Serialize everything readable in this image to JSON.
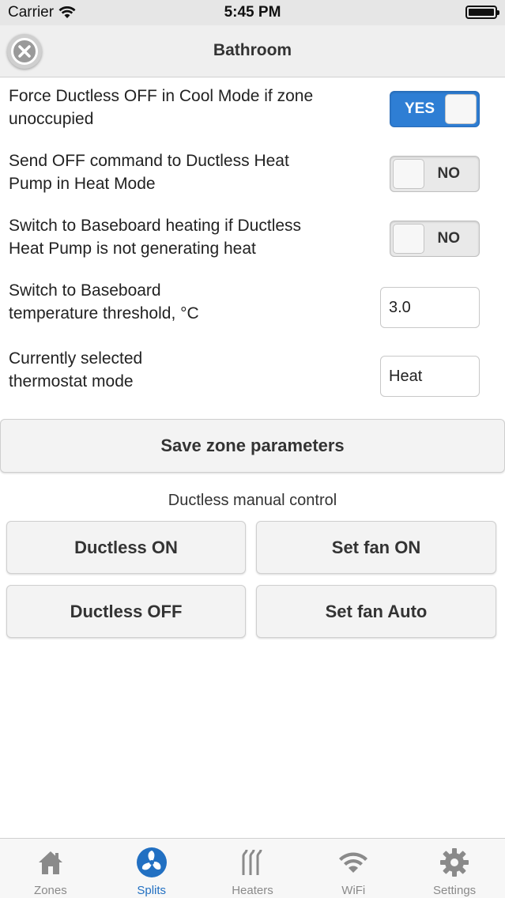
{
  "status_bar": {
    "carrier": "Carrier",
    "time": "5:45 PM"
  },
  "header": {
    "title": "Bathroom"
  },
  "settings": {
    "force_ductless_off": {
      "label_line1": "Force Ductless OFF in Cool Mode if zone",
      "label_line2": "unoccupied",
      "value": "YES",
      "on": true
    },
    "send_off_command": {
      "label_line1": "Send OFF command to Ductless Heat",
      "label_line2": "Pump in Heat Mode",
      "value": "NO",
      "on": false
    },
    "switch_to_baseboard": {
      "label_line1": "Switch to Baseboard heating if Ductless",
      "label_line2": "Heat Pump is not generating heat",
      "value": "NO",
      "on": false
    },
    "baseboard_threshold": {
      "label_line1": "Switch to Baseboard",
      "label_line2": "temperature threshold, °C",
      "value": "3.0"
    },
    "thermostat_mode": {
      "label_line1": "Currently selected",
      "label_line2": "thermostat mode",
      "value": "Heat"
    }
  },
  "save_button": "Save zone parameters",
  "manual_control": {
    "title": "Ductless manual control",
    "ductless_on": "Ductless ON",
    "set_fan_on": "Set fan ON",
    "ductless_off": "Ductless OFF",
    "set_fan_auto": "Set fan Auto"
  },
  "tab_bar": {
    "tabs": [
      {
        "label": "Zones",
        "icon": "home-icon",
        "active": false
      },
      {
        "label": "Splits",
        "icon": "fan-icon",
        "active": true
      },
      {
        "label": "Heaters",
        "icon": "heater-icon",
        "active": false
      },
      {
        "label": "WiFi",
        "icon": "wifi-icon",
        "active": false
      },
      {
        "label": "Settings",
        "icon": "gear-icon",
        "active": false
      }
    ]
  },
  "colors": {
    "accent": "#2e7ed4",
    "active_tab": "#2270c2",
    "inactive_tab": "#8a8a8a"
  }
}
